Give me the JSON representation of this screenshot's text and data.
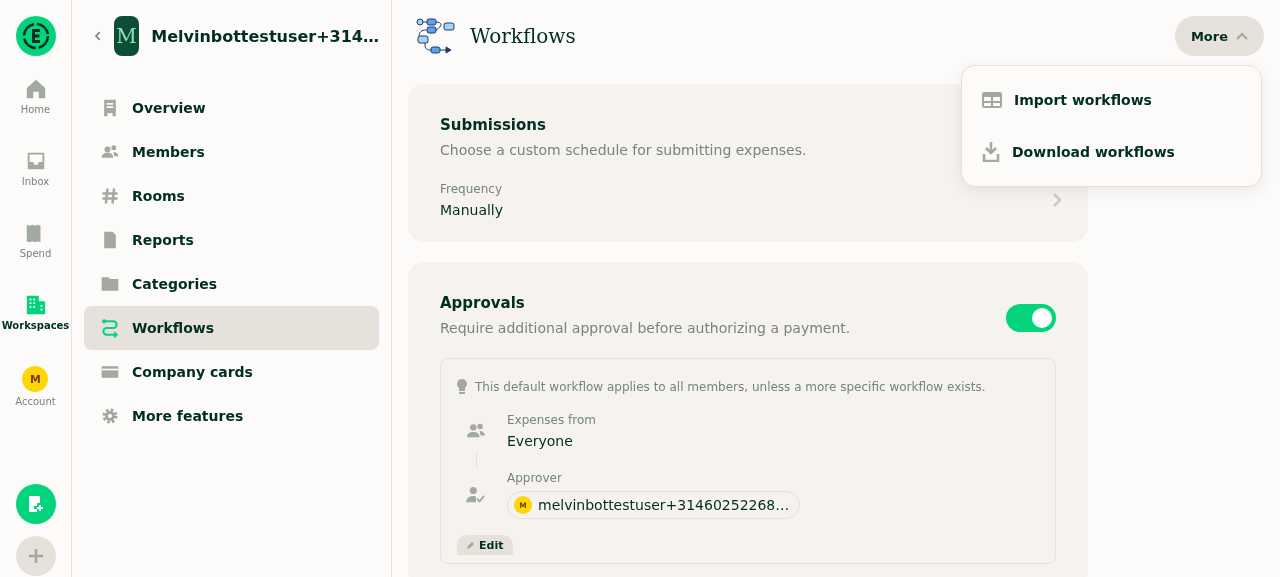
{
  "rail": {
    "items": [
      {
        "kind": "home",
        "label": "Home",
        "selected": false
      },
      {
        "kind": "inbox",
        "label": "Inbox",
        "selected": false
      },
      {
        "kind": "spend",
        "label": "Spend",
        "selected": false
      },
      {
        "kind": "workspaces",
        "label": "Workspaces",
        "selected": true
      },
      {
        "kind": "account",
        "label": "Account",
        "selected": false,
        "initial": "M"
      }
    ]
  },
  "sidebar": {
    "workspace_name": "Melvinbottestuser+314…",
    "workspace_initial": "M",
    "items": [
      {
        "kind": "overview",
        "label": "Overview",
        "selected": false
      },
      {
        "kind": "members",
        "label": "Members",
        "selected": false
      },
      {
        "kind": "rooms",
        "label": "Rooms",
        "selected": false
      },
      {
        "kind": "reports",
        "label": "Reports",
        "selected": false
      },
      {
        "kind": "categories",
        "label": "Categories",
        "selected": false
      },
      {
        "kind": "workflows",
        "label": "Workflows",
        "selected": true
      },
      {
        "kind": "cards",
        "label": "Company cards",
        "selected": false
      },
      {
        "kind": "features",
        "label": "More features",
        "selected": false
      }
    ]
  },
  "header": {
    "title": "Workflows",
    "more_button": {
      "label": "More",
      "expanded": true
    }
  },
  "more_menu": [
    {
      "kind": "import",
      "label": "Import workflows"
    },
    {
      "kind": "download",
      "label": "Download workflows"
    }
  ],
  "submissions": {
    "title": "Submissions",
    "description": "Choose a custom schedule for submitting expenses.",
    "field_label": "Frequency",
    "field_value": "Manually"
  },
  "approvals": {
    "title": "Approvals",
    "description": "Require additional approval before authorizing a payment.",
    "on": true,
    "hint": "This default workflow applies to all members, unless a more specific workflow exists.",
    "expenses_label": "Expenses from",
    "expenses_value": "Everyone",
    "approver_label": "Approver",
    "approver": "melvinbottestuser+31460252268…",
    "approver_initial": "M",
    "edit_label": "Edit"
  }
}
